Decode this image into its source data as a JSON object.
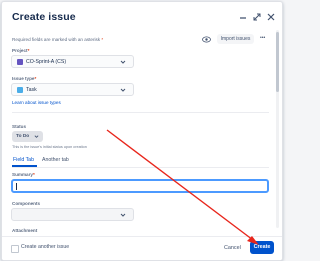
{
  "header": {
    "title": "Create issue"
  },
  "top_bar": {
    "required_note": "Required fields are marked with an asterisk",
    "required_star": "*",
    "import_label": "Import issues",
    "more_label": "•••"
  },
  "project": {
    "label": "Project",
    "value": "CO-Sprint-A (CS)"
  },
  "issue_type": {
    "label": "Issue type",
    "value": "Task",
    "learn_link": "Learn about issue types"
  },
  "status": {
    "label": "Status",
    "value": "To Do",
    "hint": "This is the issue's initial status upon creation"
  },
  "tabs": [
    {
      "label": "Field Tab"
    },
    {
      "label": "Another tab"
    }
  ],
  "summary": {
    "label": "Summary",
    "value": ""
  },
  "components": {
    "label": "Components",
    "value": ""
  },
  "attachment": {
    "label": "Attachment"
  },
  "footer": {
    "create_another_label": "Create another issue",
    "cancel_label": "Cancel",
    "create_label": "Create"
  },
  "colors": {
    "primary": "#0052cc",
    "arrow": "#e8261c",
    "focus_ring": "#4c9aff"
  },
  "icons": [
    "minimize-icon",
    "expand-icon",
    "close-icon",
    "eye-icon",
    "chevron-down-icon",
    "project-icon",
    "task-icon"
  ]
}
